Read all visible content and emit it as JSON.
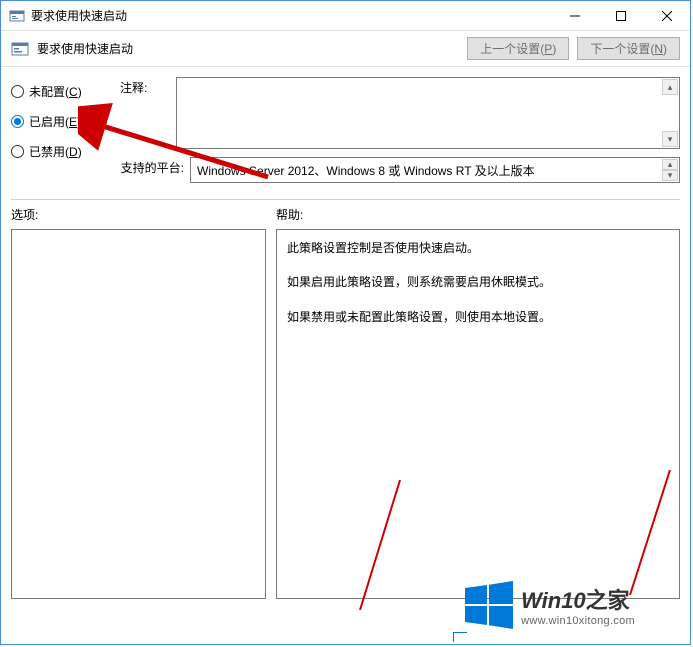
{
  "titlebar": {
    "title": "要求使用快速启动"
  },
  "toolbar": {
    "title": "要求使用快速启动",
    "prev_label": "上一个设置",
    "prev_hotkey": "P",
    "next_label": "下一个设置",
    "next_hotkey": "N"
  },
  "radios": {
    "not_configured": "未配置",
    "not_configured_hotkey": "C",
    "enabled": "已启用",
    "enabled_hotkey": "E",
    "disabled": "已禁用",
    "disabled_hotkey": "D",
    "selected": "enabled"
  },
  "fields": {
    "comment_label": "注释:",
    "comment_value": "",
    "platform_label": "支持的平台:",
    "platform_value": "Windows Server 2012、Windows 8 或 Windows RT 及以上版本"
  },
  "sections": {
    "options_label": "选项:",
    "help_label": "帮助:"
  },
  "help": {
    "p1": "此策略设置控制是否使用快速启动。",
    "p2": "如果启用此策略设置，则系统需要启用休眠模式。",
    "p3": "如果禁用或未配置此策略设置，则使用本地设置。"
  },
  "watermark": {
    "main": "Win10",
    "suffix": "之家",
    "url": "www.win10xitong.com"
  }
}
